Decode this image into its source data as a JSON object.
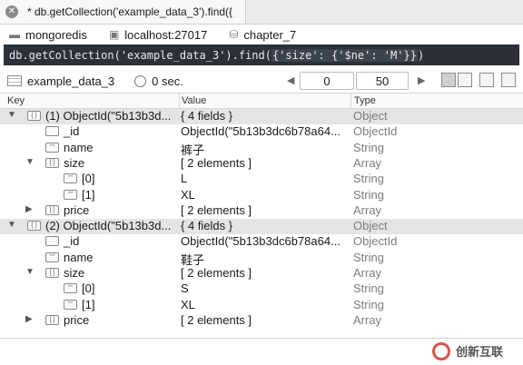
{
  "tab": {
    "title": "* db.getCollection('example_data_3').find({"
  },
  "connection": {
    "server": "mongoredis",
    "host": "localhost:27017",
    "database": "chapter_7"
  },
  "query": {
    "pre": "db.getCollection('example_data_3').find(",
    "highlight": "{'size': {'$ne': 'M'}}",
    "post": ")"
  },
  "toolbar": {
    "collection": "example_data_3",
    "time": "0 sec.",
    "skip": "0",
    "limit": "50"
  },
  "columns": {
    "key": "Key",
    "value": "Value",
    "type": "Type"
  },
  "rows": [
    {
      "key": "(1) ObjectId(\"5b13b3d...",
      "value": "{ 4 fields }",
      "type": "Object",
      "icon": "object-icon"
    },
    {
      "key": "_id",
      "value": "ObjectId(\"5b13b3dc6b78a64...",
      "type": "ObjectId",
      "icon": "id-icon"
    },
    {
      "key": "name",
      "value": "裤子",
      "type": "String",
      "icon": "string-icon"
    },
    {
      "key": "size",
      "value": "[ 2 elements ]",
      "type": "Array",
      "icon": "array-icon"
    },
    {
      "key": "[0]",
      "value": "L",
      "type": "String",
      "icon": "string-icon"
    },
    {
      "key": "[1]",
      "value": "XL",
      "type": "String",
      "icon": "string-icon"
    },
    {
      "key": "price",
      "value": "[ 2 elements ]",
      "type": "Array",
      "icon": "array-icon"
    },
    {
      "key": "(2) ObjectId(\"5b13b3d...",
      "value": "{ 4 fields }",
      "type": "Object",
      "icon": "object-icon"
    },
    {
      "key": "_id",
      "value": "ObjectId(\"5b13b3dc6b78a64...",
      "type": "ObjectId",
      "icon": "id-icon"
    },
    {
      "key": "name",
      "value": "鞋子",
      "type": "String",
      "icon": "string-icon"
    },
    {
      "key": "size",
      "value": "[ 2 elements ]",
      "type": "Array",
      "icon": "array-icon"
    },
    {
      "key": "[0]",
      "value": "S",
      "type": "String",
      "icon": "string-icon"
    },
    {
      "key": "[1]",
      "value": "XL",
      "type": "String",
      "icon": "string-icon"
    },
    {
      "key": "price",
      "value": "[ 2 elements ]",
      "type": "Array",
      "icon": "array-icon"
    }
  ],
  "watermark": {
    "text": "创新互联"
  }
}
